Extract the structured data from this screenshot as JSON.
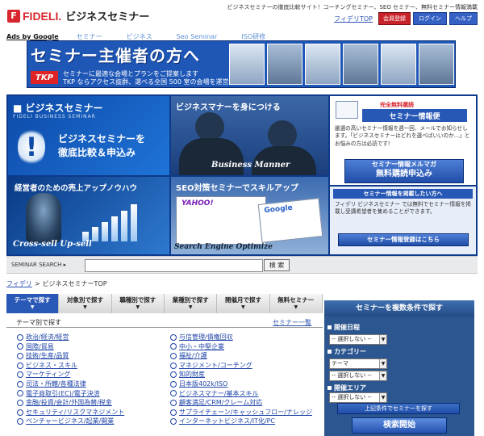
{
  "header": {
    "logo_mark": "F",
    "brand": "FIDELI.",
    "site_name": "ビジネスセミナー",
    "tagline": "ビジネスセミナーの徹底比較サイト！コーチングセミナー、SEO セミナー、無料セミナー情報満載",
    "link_top": "フィデリTOP",
    "btn_register": "会員登録",
    "btn_login": "ログイン",
    "btn_help": "ヘルプ"
  },
  "ads": {
    "ads_by": "Ads by Google",
    "links": [
      "セミナー",
      "ビジネス",
      "Seo Seminar",
      "ISO研修"
    ]
  },
  "banner": {
    "title": "セミナー主催者の方へ",
    "badge": "TKP",
    "line1": "セミナーに最適な会場とプランをご提案します",
    "line2": "TKP ならアクセス抜群、選べる全国 500 室の会場を運営"
  },
  "hero": {
    "p1_title": "■ ビジネスセミナー",
    "p1_sub": "FIDELI BUSINESS SEMINAR",
    "p1_big1": "ビジネスセミナーを",
    "p1_big2": "徹底比較＆申込み",
    "p1_excl": "!",
    "p2_title": "ビジネスマナーを身につける",
    "p2_caption": "Business Manner",
    "p3_title": "経営者のための売上アップノウハウ",
    "p3_caption": "Cross-sell  Up-sell",
    "p4_title": "SEO対策セミナーでスキルアップ",
    "p4_caption": "Search Engine Optimize",
    "p4_yahoo": "YAHOO!",
    "p4_google": "Google",
    "r1_top": "完全無料購読",
    "r1_title": "セミナー情報便",
    "r1_text": "厳選の高いセミナー情報を週一回、メールでお知らせします。「ビジネスセミナーはどれを選べばいいのか…」とお悩みの方は必読です!",
    "r1_btn1": "セミナー情報メルマガ",
    "r1_btn2": "無料購読申込み",
    "r6_title": "セミナー情報を掲載したい方へ",
    "r6_text": "フィデリ ビジネスセミナー では無料でセミナー情報を掲載し受講希望者を集めることができます。",
    "r6_btn": "セミナー情報登録はこちら"
  },
  "search": {
    "label": "SEMINAR SEARCH ▸",
    "value": "",
    "button": "検 索"
  },
  "breadcrumb": {
    "home": "フィデリ",
    "sep": ">",
    "current": "ビジネスセミナーTOP"
  },
  "tabs": [
    "テーマで探す",
    "対象別で探す",
    "職種別で探す",
    "業種別で探す",
    "開催月で探す",
    "無料セミナー"
  ],
  "topic": {
    "label": "テーマ別で探す",
    "all_link": "セミナー一覧"
  },
  "topics_left": [
    "政治/経済/経営",
    "国際/貿易",
    "技術/生産/品質",
    "ビジネス・スキル",
    "マーケティング",
    "司法・所轄/各種法律",
    "電子商取引(EC)/電子決済",
    "金融/投資/会計/外国為替/税金",
    "セキュリティ/リスクマネジメント",
    "ベンチャービジネス/起業/開業"
  ],
  "topics_right": [
    "与信管理/債権回収",
    "中小・中堅企業",
    "福祉/介護",
    "マネジメント/コーチング",
    "知的財産",
    "日本版402k/ISO",
    "ビジネスマナー/基本スキル",
    "顧客満足/CRM/クレーム対応",
    "サプライチェーン/キャッシュフロー/ナレッジ",
    "インターネットビジネス/IT化/PC"
  ],
  "side_search": {
    "title": "セミナーを複数条件で探す",
    "date_label": "開催日程",
    "date_value": "-- 選択しない --",
    "category_label": "カテゴリー",
    "category_value": "テーマ",
    "category_sub_value": "-- 選択しない --",
    "area_label": "開催エリア",
    "area_value": "-- 選択しない --",
    "btn_cond": "上記条件でセミナーを探す",
    "btn_search": "検索開始"
  }
}
